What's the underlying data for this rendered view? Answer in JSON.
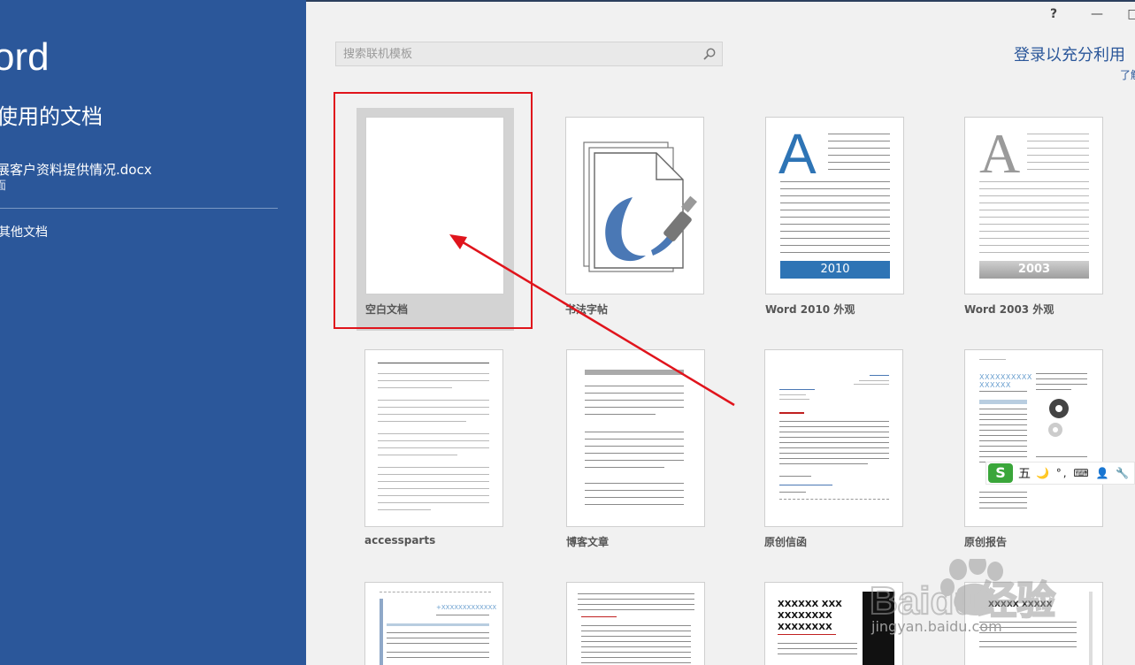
{
  "sidebar": {
    "app_title": "ord",
    "recent_heading": "使用的文档",
    "recent_file_name": "展客户资料提供情况.docx",
    "recent_file_path": "面",
    "open_other": "其他文档"
  },
  "window": {
    "help": "?",
    "minimize": "—",
    "restore": "□"
  },
  "search": {
    "placeholder": "搜索联机模板"
  },
  "account": {
    "signin": "登录以充分利用",
    "learn_more": "了解"
  },
  "templates": [
    {
      "label": "空白文档"
    },
    {
      "label": "书法字帖"
    },
    {
      "label": "Word 2010 外观",
      "badge": "2010"
    },
    {
      "label": "Word 2003 外观",
      "badge": "2003"
    },
    {
      "label": "accessparts"
    },
    {
      "label": "博客文章"
    },
    {
      "label": "原创信函"
    },
    {
      "label": "原创报告"
    }
  ],
  "ime": {
    "logo": "S",
    "mode": "五",
    "symbols": "🌙 °, ⌨ 👤 🔧"
  },
  "watermark": {
    "brand": "Baidu经验",
    "url": "jingyan.baidu.com"
  },
  "colors": {
    "sidebar_blue": "#2b579a",
    "highlight_red": "#e0141c",
    "badge_2010": "#2e74b5",
    "badge_2003": "#b0b0b0"
  }
}
